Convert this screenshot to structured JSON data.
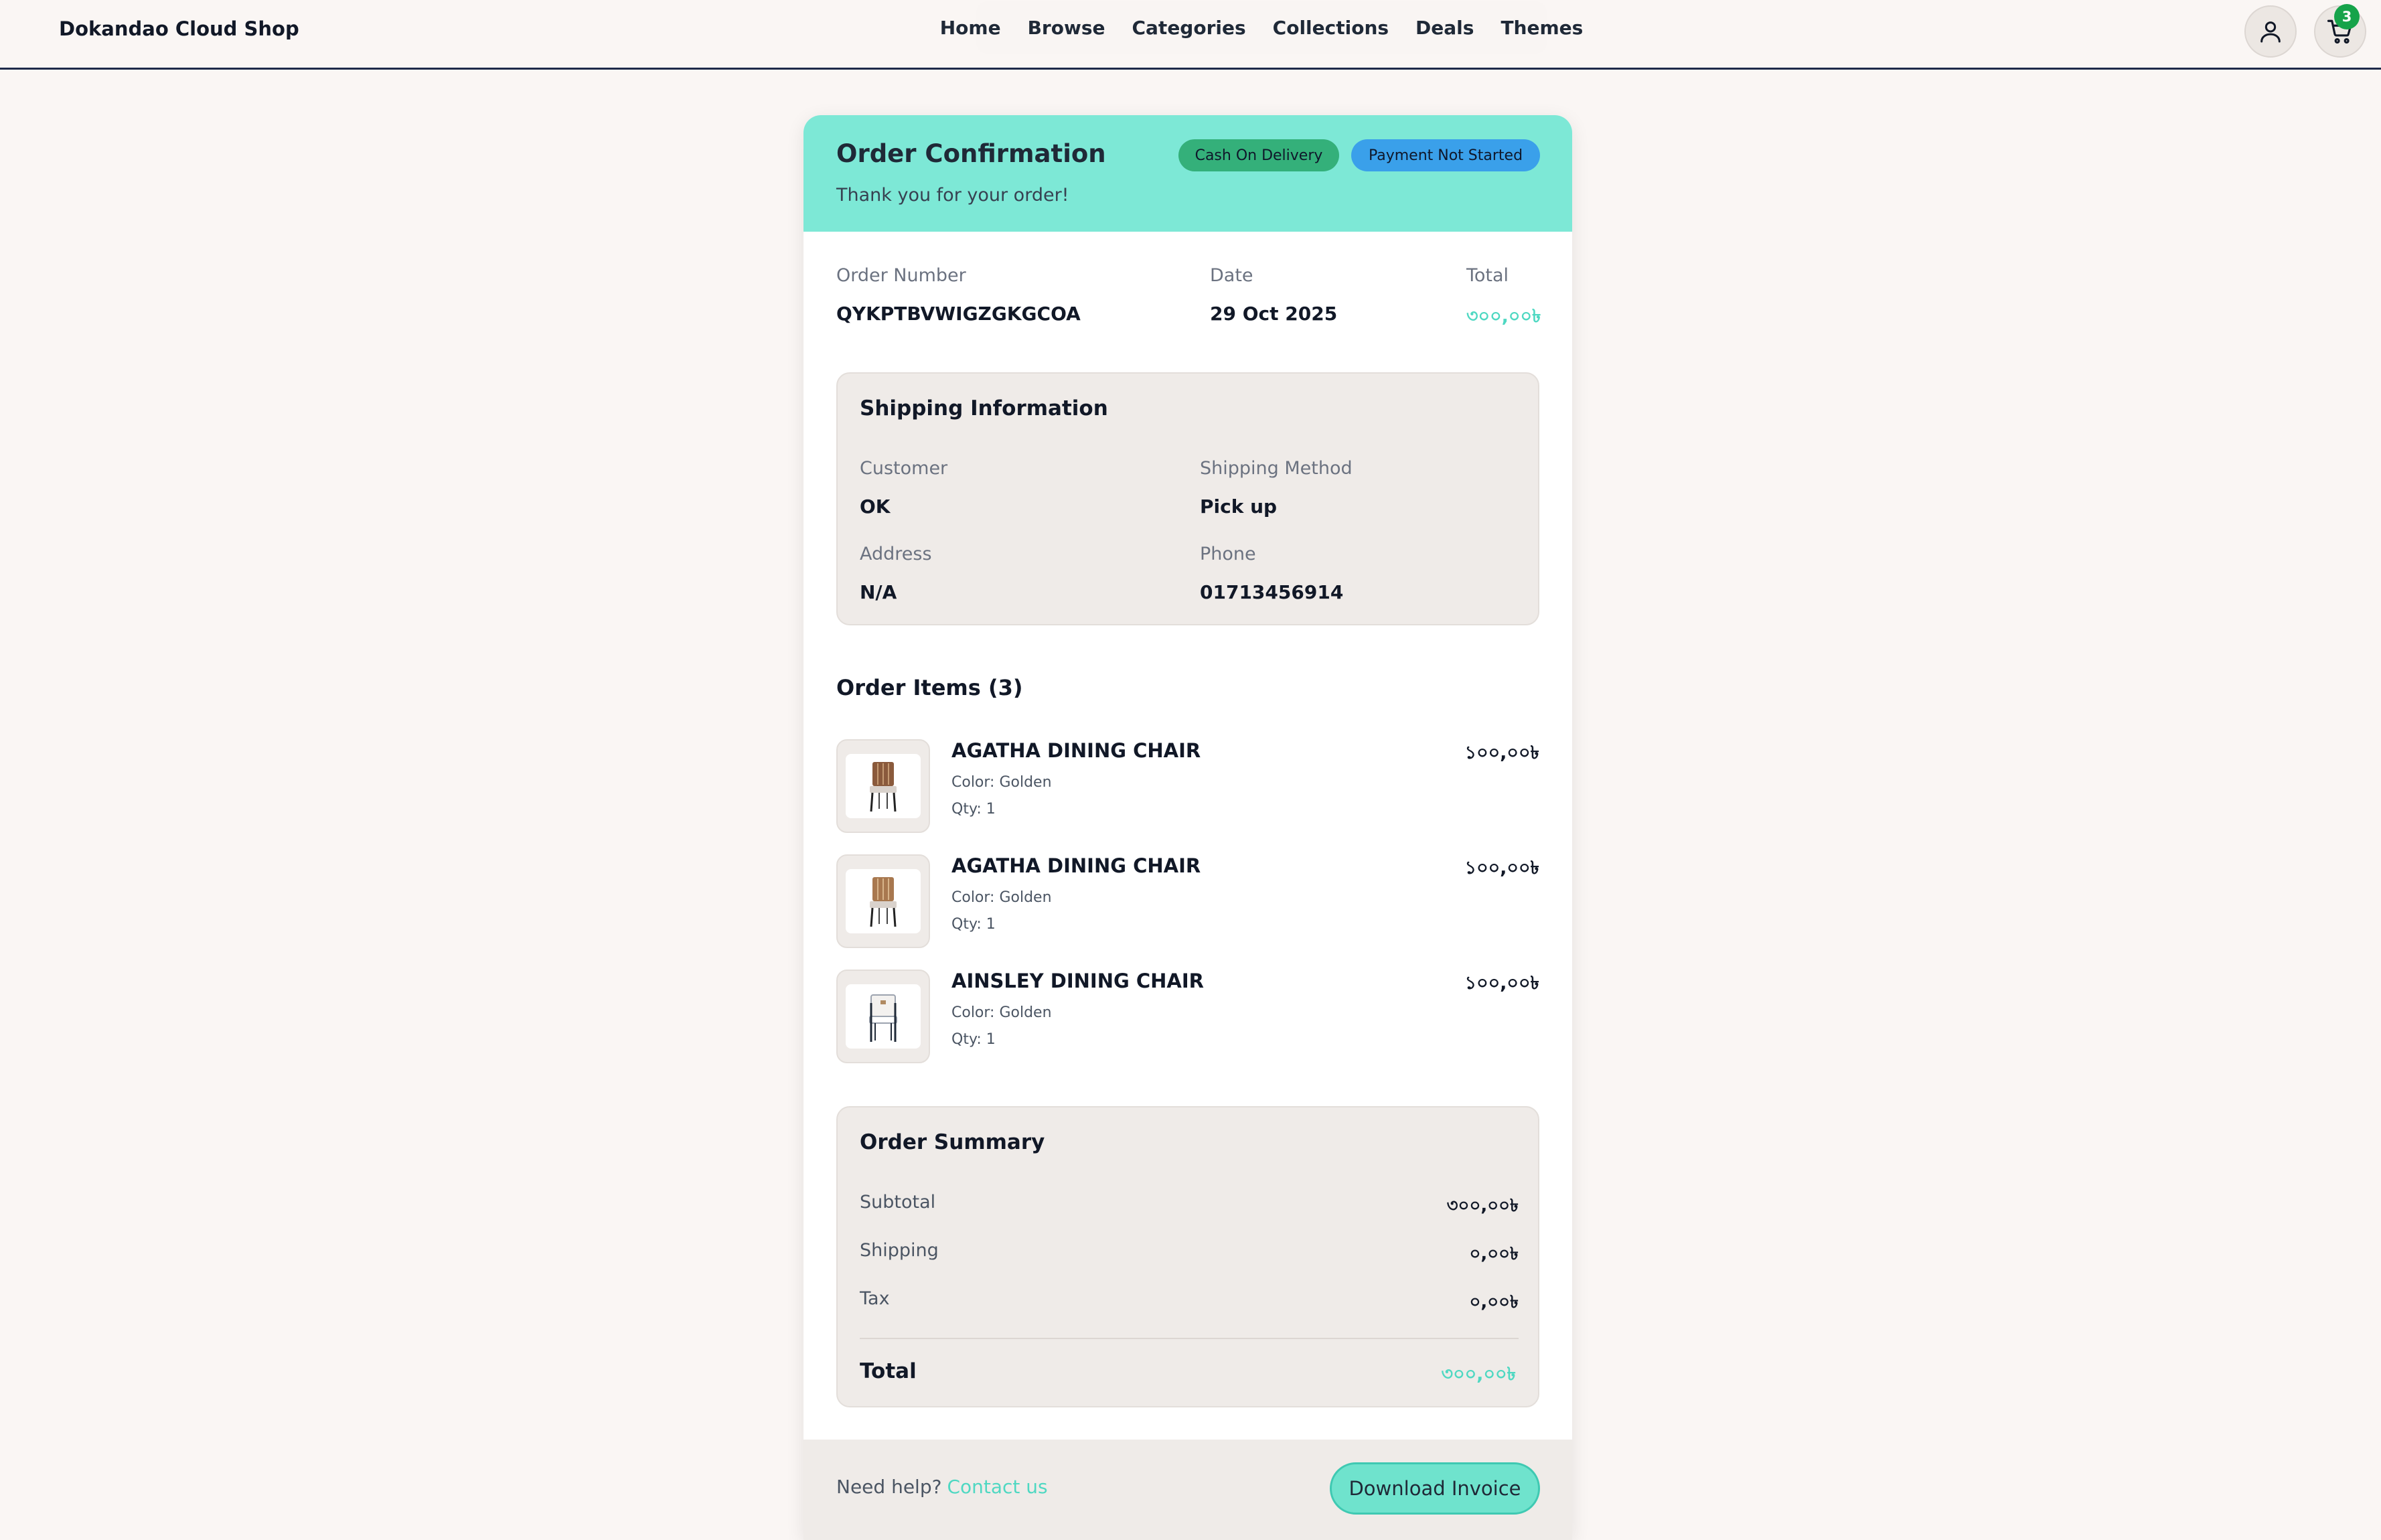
{
  "header": {
    "brand": "Dokandao Cloud Shop",
    "nav": [
      "Home",
      "Browse",
      "Categories",
      "Collections",
      "Deals",
      "Themes"
    ],
    "user_icon": "user-icon",
    "cart_icon": "cart-icon",
    "cart_count": "3"
  },
  "order": {
    "title": "Order Confirmation",
    "subtitle": "Thank you for your order!",
    "badges": {
      "payment_method": "Cash On Delivery",
      "payment_status": "Payment Not Started"
    },
    "meta": {
      "number_label": "Order Number",
      "number": "QYKPTBVWIGZGKGCOA",
      "date_label": "Date",
      "date": "29 Oct 2025",
      "total_label": "Total",
      "total": "৩০০,০০৳"
    },
    "shipping": {
      "title": "Shipping Information",
      "customer_label": "Customer",
      "customer": "OK",
      "method_label": "Shipping Method",
      "method": "Pick up",
      "address_label": "Address",
      "address": "N/A",
      "phone_label": "Phone",
      "phone": "01713456914"
    },
    "items_title": "Order Items (3)",
    "items": [
      {
        "name": "AGATHA DINING CHAIR",
        "attr": "Color: Golden",
        "qty": "Qty: 1",
        "price": "১০০,০০৳"
      },
      {
        "name": "AGATHA DINING CHAIR",
        "attr": "Color: Golden",
        "qty": "Qty: 1",
        "price": "১০০,০০৳"
      },
      {
        "name": "AINSLEY DINING CHAIR",
        "attr": "Color: Golden",
        "qty": "Qty: 1",
        "price": "১০০,০০৳"
      }
    ],
    "summary": {
      "title": "Order Summary",
      "subtotal_label": "Subtotal",
      "subtotal": "৩০০,০০৳",
      "shipping_label": "Shipping",
      "shipping": "০,০০৳",
      "tax_label": "Tax",
      "tax": "০,০০৳",
      "total_label": "Total",
      "total": "৩০০,০০৳"
    },
    "footer": {
      "help_text": "Need help?",
      "help_link": "Contact us",
      "download_label": "Download Invoice"
    }
  },
  "colors": {
    "accent": "#7de8d6",
    "accent_text": "#4fd8c2",
    "badge_cod": "#34b07a",
    "badge_payment": "#3aa0ea",
    "cart_badge": "#16a34a"
  }
}
